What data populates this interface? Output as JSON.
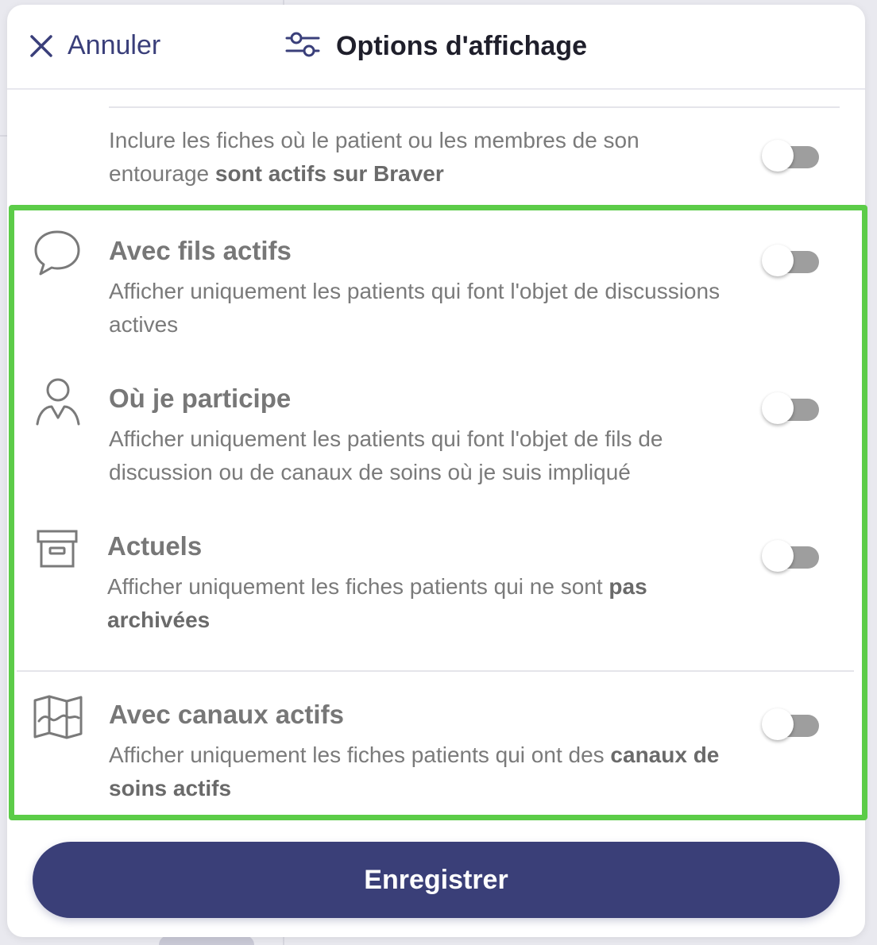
{
  "header": {
    "cancel_label": "Annuler",
    "title": "Options d'affichage"
  },
  "options": [
    {
      "icon": "none",
      "title": "",
      "desc_plain": "Inclure les fiches où le patient ou les membres de son entourage ",
      "desc_bold": "sont actifs sur Braver",
      "enabled": false
    },
    {
      "icon": "speech-bubble-icon",
      "title": "Avec fils actifs",
      "desc_plain": "Afficher uniquement les patients qui font l'objet de discussions actives",
      "desc_bold": "",
      "enabled": false
    },
    {
      "icon": "person-icon",
      "title": "Où je participe",
      "desc_plain": "Afficher uniquement les patients qui font l'objet de fils de discussion ou de canaux de soins où je suis impliqué",
      "desc_bold": "",
      "enabled": false
    },
    {
      "icon": "archive-box-icon",
      "title": "Actuels",
      "desc_plain": "Afficher uniquement les fiches patients qui ne sont ",
      "desc_bold": "pas archivées",
      "enabled": false
    },
    {
      "icon": "map-icon",
      "title": "Avec canaux actifs",
      "desc_plain": "Afficher uniquement les fiches patients qui ont des ",
      "desc_bold": "canaux de soins actifs",
      "enabled": false
    }
  ],
  "footer": {
    "save_label": "Enregistrer"
  },
  "colors": {
    "accent": "#3a3f78",
    "highlight": "#5ccc48",
    "toggle_off": "#9e9e9e"
  }
}
